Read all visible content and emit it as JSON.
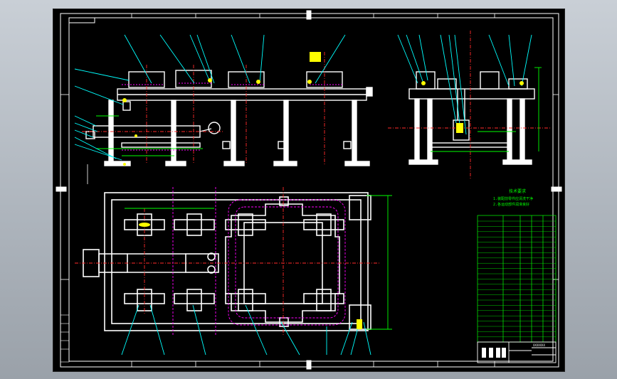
{
  "viewport": {
    "background": "#000000",
    "name": "model-space"
  },
  "colors": {
    "frame": "#ffffff",
    "outline": "#ffffff",
    "dimension": "#00ff00",
    "leader": "#00ffff",
    "centerline": "#ff2a2a",
    "hidden": "#ff00ff",
    "highlight": "#ffff00",
    "table": "#00ff00"
  },
  "drawing": {
    "border_tabs": [
      "A",
      "B",
      "C",
      "D",
      "E",
      "F",
      "G",
      "H"
    ],
    "notes_title": "技术要求",
    "notes": [
      "1.装配前零件应清洗干净",
      "2.各运动部件润滑良好"
    ],
    "title_block_label": "XXXXXXX"
  },
  "icons": {
    "yellow_marker": "highlight-marker-icon"
  }
}
